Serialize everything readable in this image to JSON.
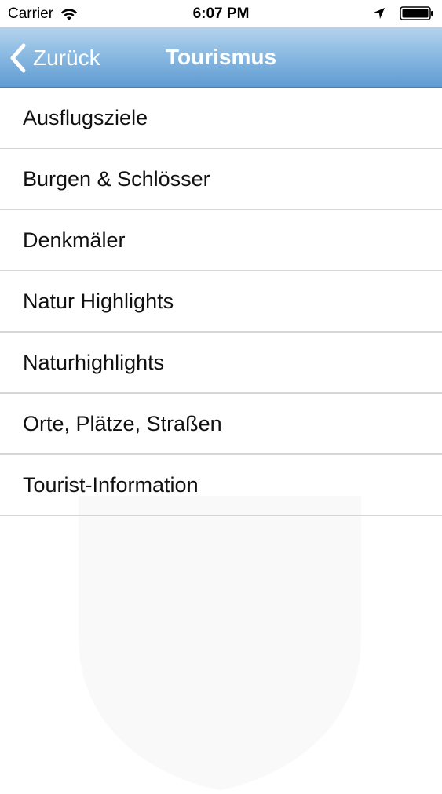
{
  "status_bar": {
    "carrier": "Carrier",
    "time": "6:07 PM",
    "icons": [
      "wifi-icon",
      "location-icon",
      "battery-icon"
    ]
  },
  "nav_bar": {
    "back_label": "Zurück",
    "title": "Tourismus",
    "icons": [
      "back-chevron-icon"
    ]
  },
  "list": {
    "items": [
      {
        "label": "Ausflugsziele"
      },
      {
        "label": "Burgen & Schlösser"
      },
      {
        "label": "Denkmäler"
      },
      {
        "label": "Natur Highlights"
      },
      {
        "label": "Naturhighlights"
      },
      {
        "label": "Orte, Plätze, Straßen"
      },
      {
        "label": "Tourist-Information"
      }
    ]
  },
  "colors": {
    "nav_gradient_top": "#b6d3ec",
    "nav_gradient_bottom": "#5f9bd2",
    "separator": "#d6d6d6",
    "text": "#111111"
  }
}
